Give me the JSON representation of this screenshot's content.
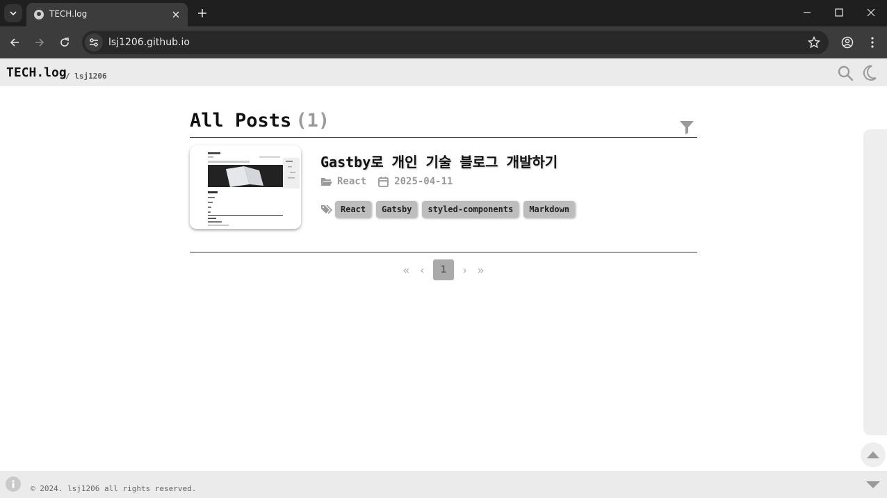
{
  "browser": {
    "tab_title": "TECH.log",
    "url": "lsj1206.github.io"
  },
  "header": {
    "brand": "TECH.log",
    "subtitle": "/ lsj1206"
  },
  "posts": {
    "heading": "All Posts",
    "count": "(1)",
    "items": [
      {
        "title": "Gastby로 개인 기술 블로그 개발하기",
        "category": "React",
        "date": "2025-04-11",
        "tags": [
          "React",
          "Gatsby",
          "styled-components",
          "Markdown"
        ]
      }
    ]
  },
  "pagination": {
    "first": "«",
    "prev": "‹",
    "current": "1",
    "next": "›",
    "last": "»"
  },
  "footer": {
    "copyright": "© 2024. lsj1206 all rights reserved."
  },
  "colors": {
    "chrome_dark": "#1f1f1f",
    "chrome_toolbar": "#3c3c3c",
    "header_bg": "#ebebeb",
    "tag_bg": "#bdbdbd",
    "muted": "#999999"
  }
}
